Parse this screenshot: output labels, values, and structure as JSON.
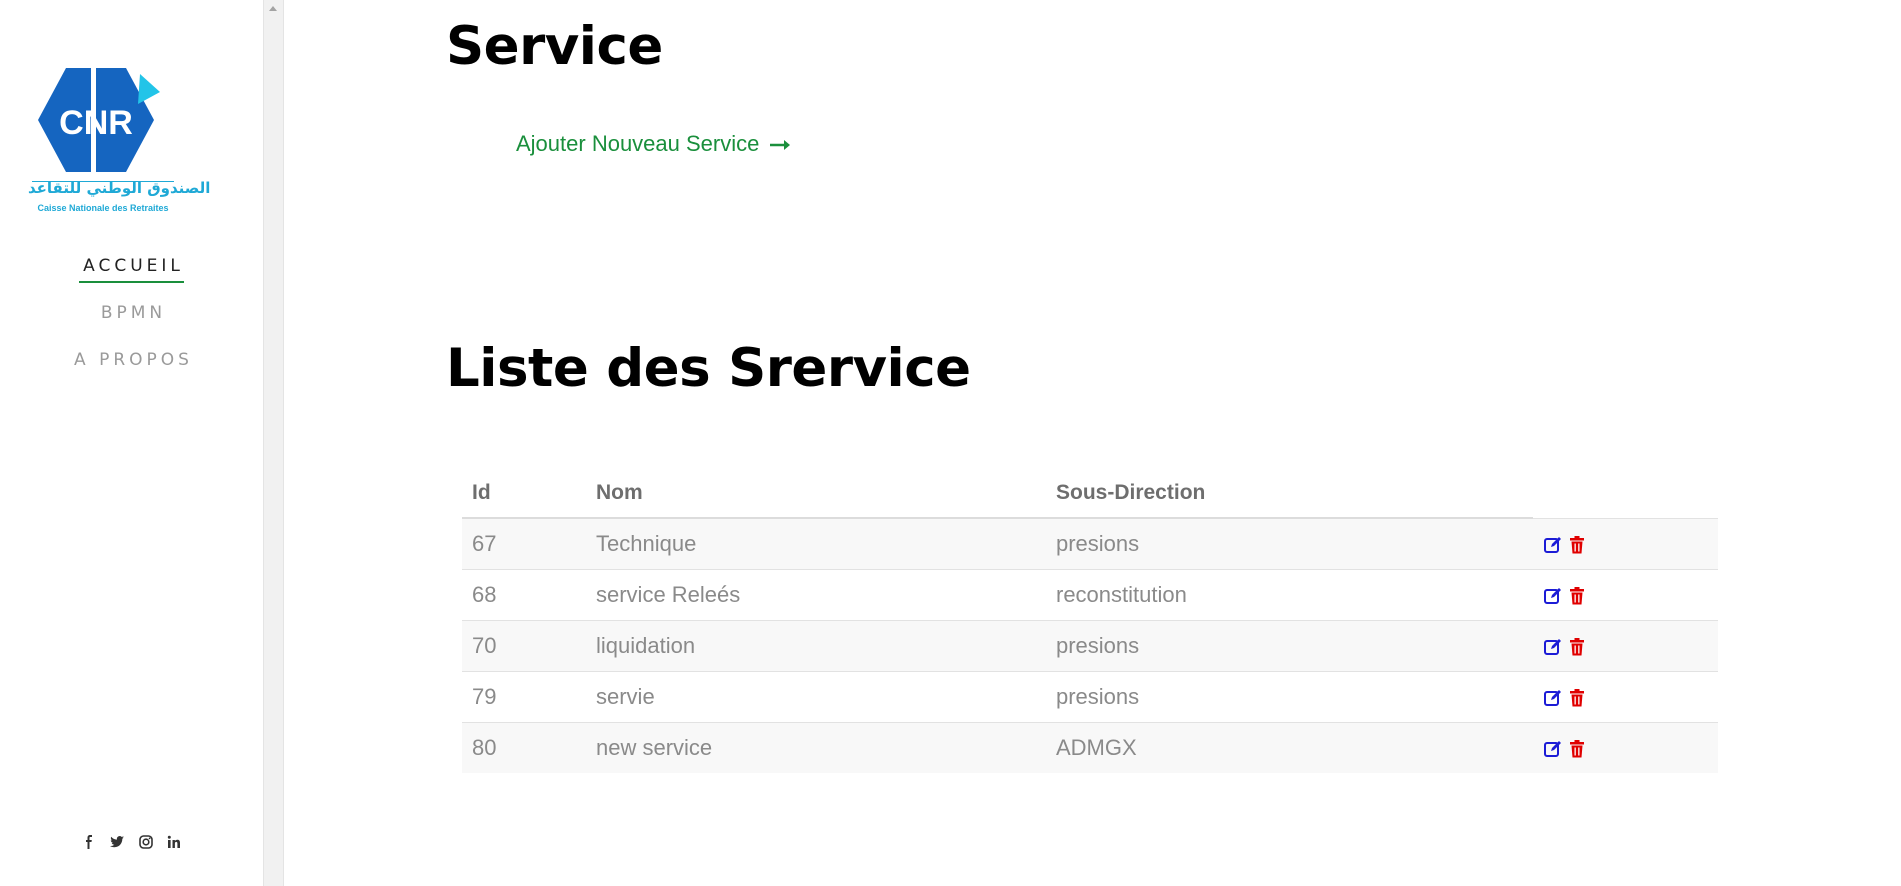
{
  "sidebar": {
    "logo": {
      "acronym": "CNR",
      "arabic_name": "الصندوق الوطني للتقاعد",
      "latin_name": "Caisse Nationale des Retraites"
    },
    "nav": [
      {
        "label": "ACCUEIL",
        "active": true
      },
      {
        "label": "BPMN",
        "active": false
      },
      {
        "label": "A PROPOS",
        "active": false
      }
    ],
    "social": [
      "facebook-icon",
      "twitter-icon",
      "instagram-icon",
      "linkedin-icon"
    ]
  },
  "main": {
    "title": "Service",
    "add_link": "Ajouter Nouveau Service",
    "list_title": "Liste des Srervice",
    "table": {
      "headers": [
        "Id",
        "Nom",
        "Sous-Direction",
        ""
      ],
      "rows": [
        {
          "id": "67",
          "nom": "Technique",
          "sous_direction": "presions"
        },
        {
          "id": "68",
          "nom": "service Releés",
          "sous_direction": "reconstitution"
        },
        {
          "id": "70",
          "nom": "liquidation",
          "sous_direction": "presions"
        },
        {
          "id": "79",
          "nom": "servie",
          "sous_direction": "presions"
        },
        {
          "id": "80",
          "nom": "new service",
          "sous_direction": "ADMGX"
        }
      ]
    }
  },
  "colors": {
    "accent_green": "#1a8f3c",
    "edit_blue": "#1c1cd6",
    "delete_red": "#e00000",
    "logo_blue": "#1565c0",
    "logo_cyan": "#1fa9d6"
  }
}
